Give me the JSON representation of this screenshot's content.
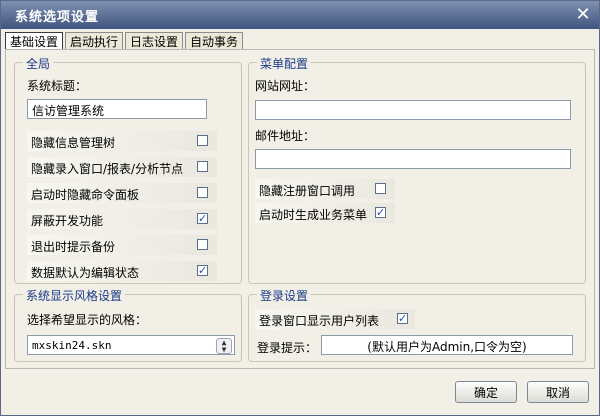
{
  "window": {
    "title": "系统选项设置"
  },
  "tabs": [
    "基础设置",
    "启动执行",
    "日志设置",
    "自动事务"
  ],
  "global": {
    "legend": "全局",
    "system_title_label": "系统标题：",
    "system_title_value": "信访管理系统",
    "options": [
      {
        "label": "隐藏信息管理树",
        "checked": false
      },
      {
        "label": "隐藏录入窗口/报表/分析节点",
        "checked": false
      },
      {
        "label": "启动时隐藏命令面板",
        "checked": false
      },
      {
        "label": "屏蔽开发功能",
        "checked": true
      },
      {
        "label": "退出时提示备份",
        "checked": false
      },
      {
        "label": "数据默认为编辑状态",
        "checked": true
      }
    ]
  },
  "menu_config": {
    "legend": "菜单配置",
    "website_label": "网站网址：",
    "website_value": "",
    "email_label": "邮件地址：",
    "email_value": "",
    "options": [
      {
        "label": "隐藏注册窗口调用",
        "checked": false
      },
      {
        "label": "启动时生成业务菜单",
        "checked": true
      }
    ]
  },
  "style": {
    "legend": "系统显示风格设置",
    "prompt": "选择希望显示的风格：",
    "selected": "mxskin24.skn"
  },
  "login": {
    "legend": "登录设置",
    "show_user_list_label": "登录窗口显示用户列表",
    "show_user_list_checked": true,
    "hint_label": "登录提示：",
    "hint_value": "(默认用户为Admin,口令为空)"
  },
  "buttons": {
    "ok": "确定",
    "cancel": "取消"
  },
  "icons": {
    "close": "close-icon",
    "check": "checkmark-icon",
    "spin": "spinner-arrows-icon"
  }
}
